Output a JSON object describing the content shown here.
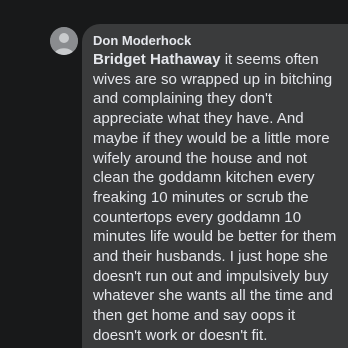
{
  "comment": {
    "author_name": "Don Moderhock",
    "mention": "Bridget Hathaway",
    "text": " it seems often wives are so wrapped up in bitching and complaining they don't appreciate what they have. And maybe if they would be a little more wifely around the house and not clean the goddamn kitchen every freaking 10 minutes or scrub the countertops every goddamn 10 minutes life would be better for them and their husbands. I just hope she doesn't run out and impulsively buy whatever she wants all the time and then get home and say oops it doesn't work or doesn't fit."
  },
  "colors": {
    "background": "#18191a",
    "bubble": "#3a3b3c",
    "text": "#e4e6eb"
  },
  "icons": {
    "avatar": "user-avatar-icon"
  }
}
